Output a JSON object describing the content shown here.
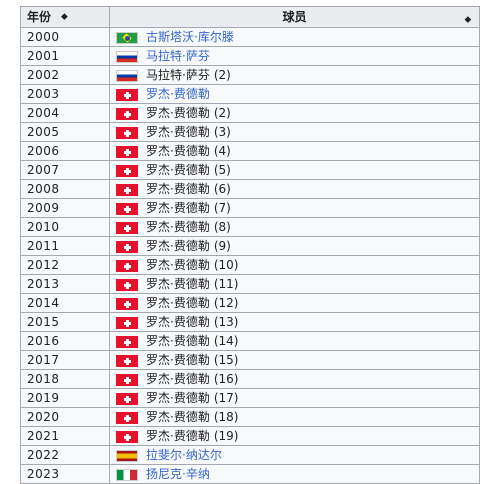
{
  "header": {
    "year_label": "年份",
    "player_label": "球员",
    "sort_glyph": "⬥"
  },
  "rows": [
    {
      "year": "2000",
      "flag": "br",
      "name": "古斯塔沃·库尔滕",
      "suffix": "",
      "linked": true
    },
    {
      "year": "2001",
      "flag": "ru",
      "name": "马拉特·萨芬",
      "suffix": "",
      "linked": true
    },
    {
      "year": "2002",
      "flag": "ru",
      "name": "马拉特·萨芬",
      "suffix": "(2)",
      "linked": false
    },
    {
      "year": "2003",
      "flag": "ch",
      "name": "罗杰·费德勒",
      "suffix": "",
      "linked": true
    },
    {
      "year": "2004",
      "flag": "ch",
      "name": "罗杰·费德勒",
      "suffix": "(2)",
      "linked": false
    },
    {
      "year": "2005",
      "flag": "ch",
      "name": "罗杰·费德勒",
      "suffix": "(3)",
      "linked": false
    },
    {
      "year": "2006",
      "flag": "ch",
      "name": "罗杰·费德勒",
      "suffix": "(4)",
      "linked": false
    },
    {
      "year": "2007",
      "flag": "ch",
      "name": "罗杰·费德勒",
      "suffix": "(5)",
      "linked": false
    },
    {
      "year": "2008",
      "flag": "ch",
      "name": "罗杰·费德勒",
      "suffix": "(6)",
      "linked": false
    },
    {
      "year": "2009",
      "flag": "ch",
      "name": "罗杰·费德勒",
      "suffix": "(7)",
      "linked": false
    },
    {
      "year": "2010",
      "flag": "ch",
      "name": "罗杰·费德勒",
      "suffix": "(8)",
      "linked": false
    },
    {
      "year": "2011",
      "flag": "ch",
      "name": "罗杰·费德勒",
      "suffix": "(9)",
      "linked": false
    },
    {
      "year": "2012",
      "flag": "ch",
      "name": "罗杰·费德勒",
      "suffix": "(10)",
      "linked": false
    },
    {
      "year": "2013",
      "flag": "ch",
      "name": "罗杰·费德勒",
      "suffix": "(11)",
      "linked": false
    },
    {
      "year": "2014",
      "flag": "ch",
      "name": "罗杰·费德勒",
      "suffix": "(12)",
      "linked": false
    },
    {
      "year": "2015",
      "flag": "ch",
      "name": "罗杰·费德勒",
      "suffix": "(13)",
      "linked": false
    },
    {
      "year": "2016",
      "flag": "ch",
      "name": "罗杰·费德勒",
      "suffix": "(14)",
      "linked": false
    },
    {
      "year": "2017",
      "flag": "ch",
      "name": "罗杰·费德勒",
      "suffix": "(15)",
      "linked": false
    },
    {
      "year": "2018",
      "flag": "ch",
      "name": "罗杰·费德勒",
      "suffix": "(16)",
      "linked": false
    },
    {
      "year": "2019",
      "flag": "ch",
      "name": "罗杰·费德勒",
      "suffix": "(17)",
      "linked": false
    },
    {
      "year": "2020",
      "flag": "ch",
      "name": "罗杰·费德勒",
      "suffix": "(18)",
      "linked": false
    },
    {
      "year": "2021",
      "flag": "ch",
      "name": "罗杰·费德勒",
      "suffix": "(19)",
      "linked": false
    },
    {
      "year": "2022",
      "flag": "es",
      "name": "拉斐尔·纳达尔",
      "suffix": "",
      "linked": true
    },
    {
      "year": "2023",
      "flag": "it",
      "name": "扬尼克·辛纳",
      "suffix": "",
      "linked": true
    }
  ],
  "colors": {
    "link": "#3366cc",
    "header_bg": "#eaecf0",
    "border": "#a2a9b1"
  }
}
